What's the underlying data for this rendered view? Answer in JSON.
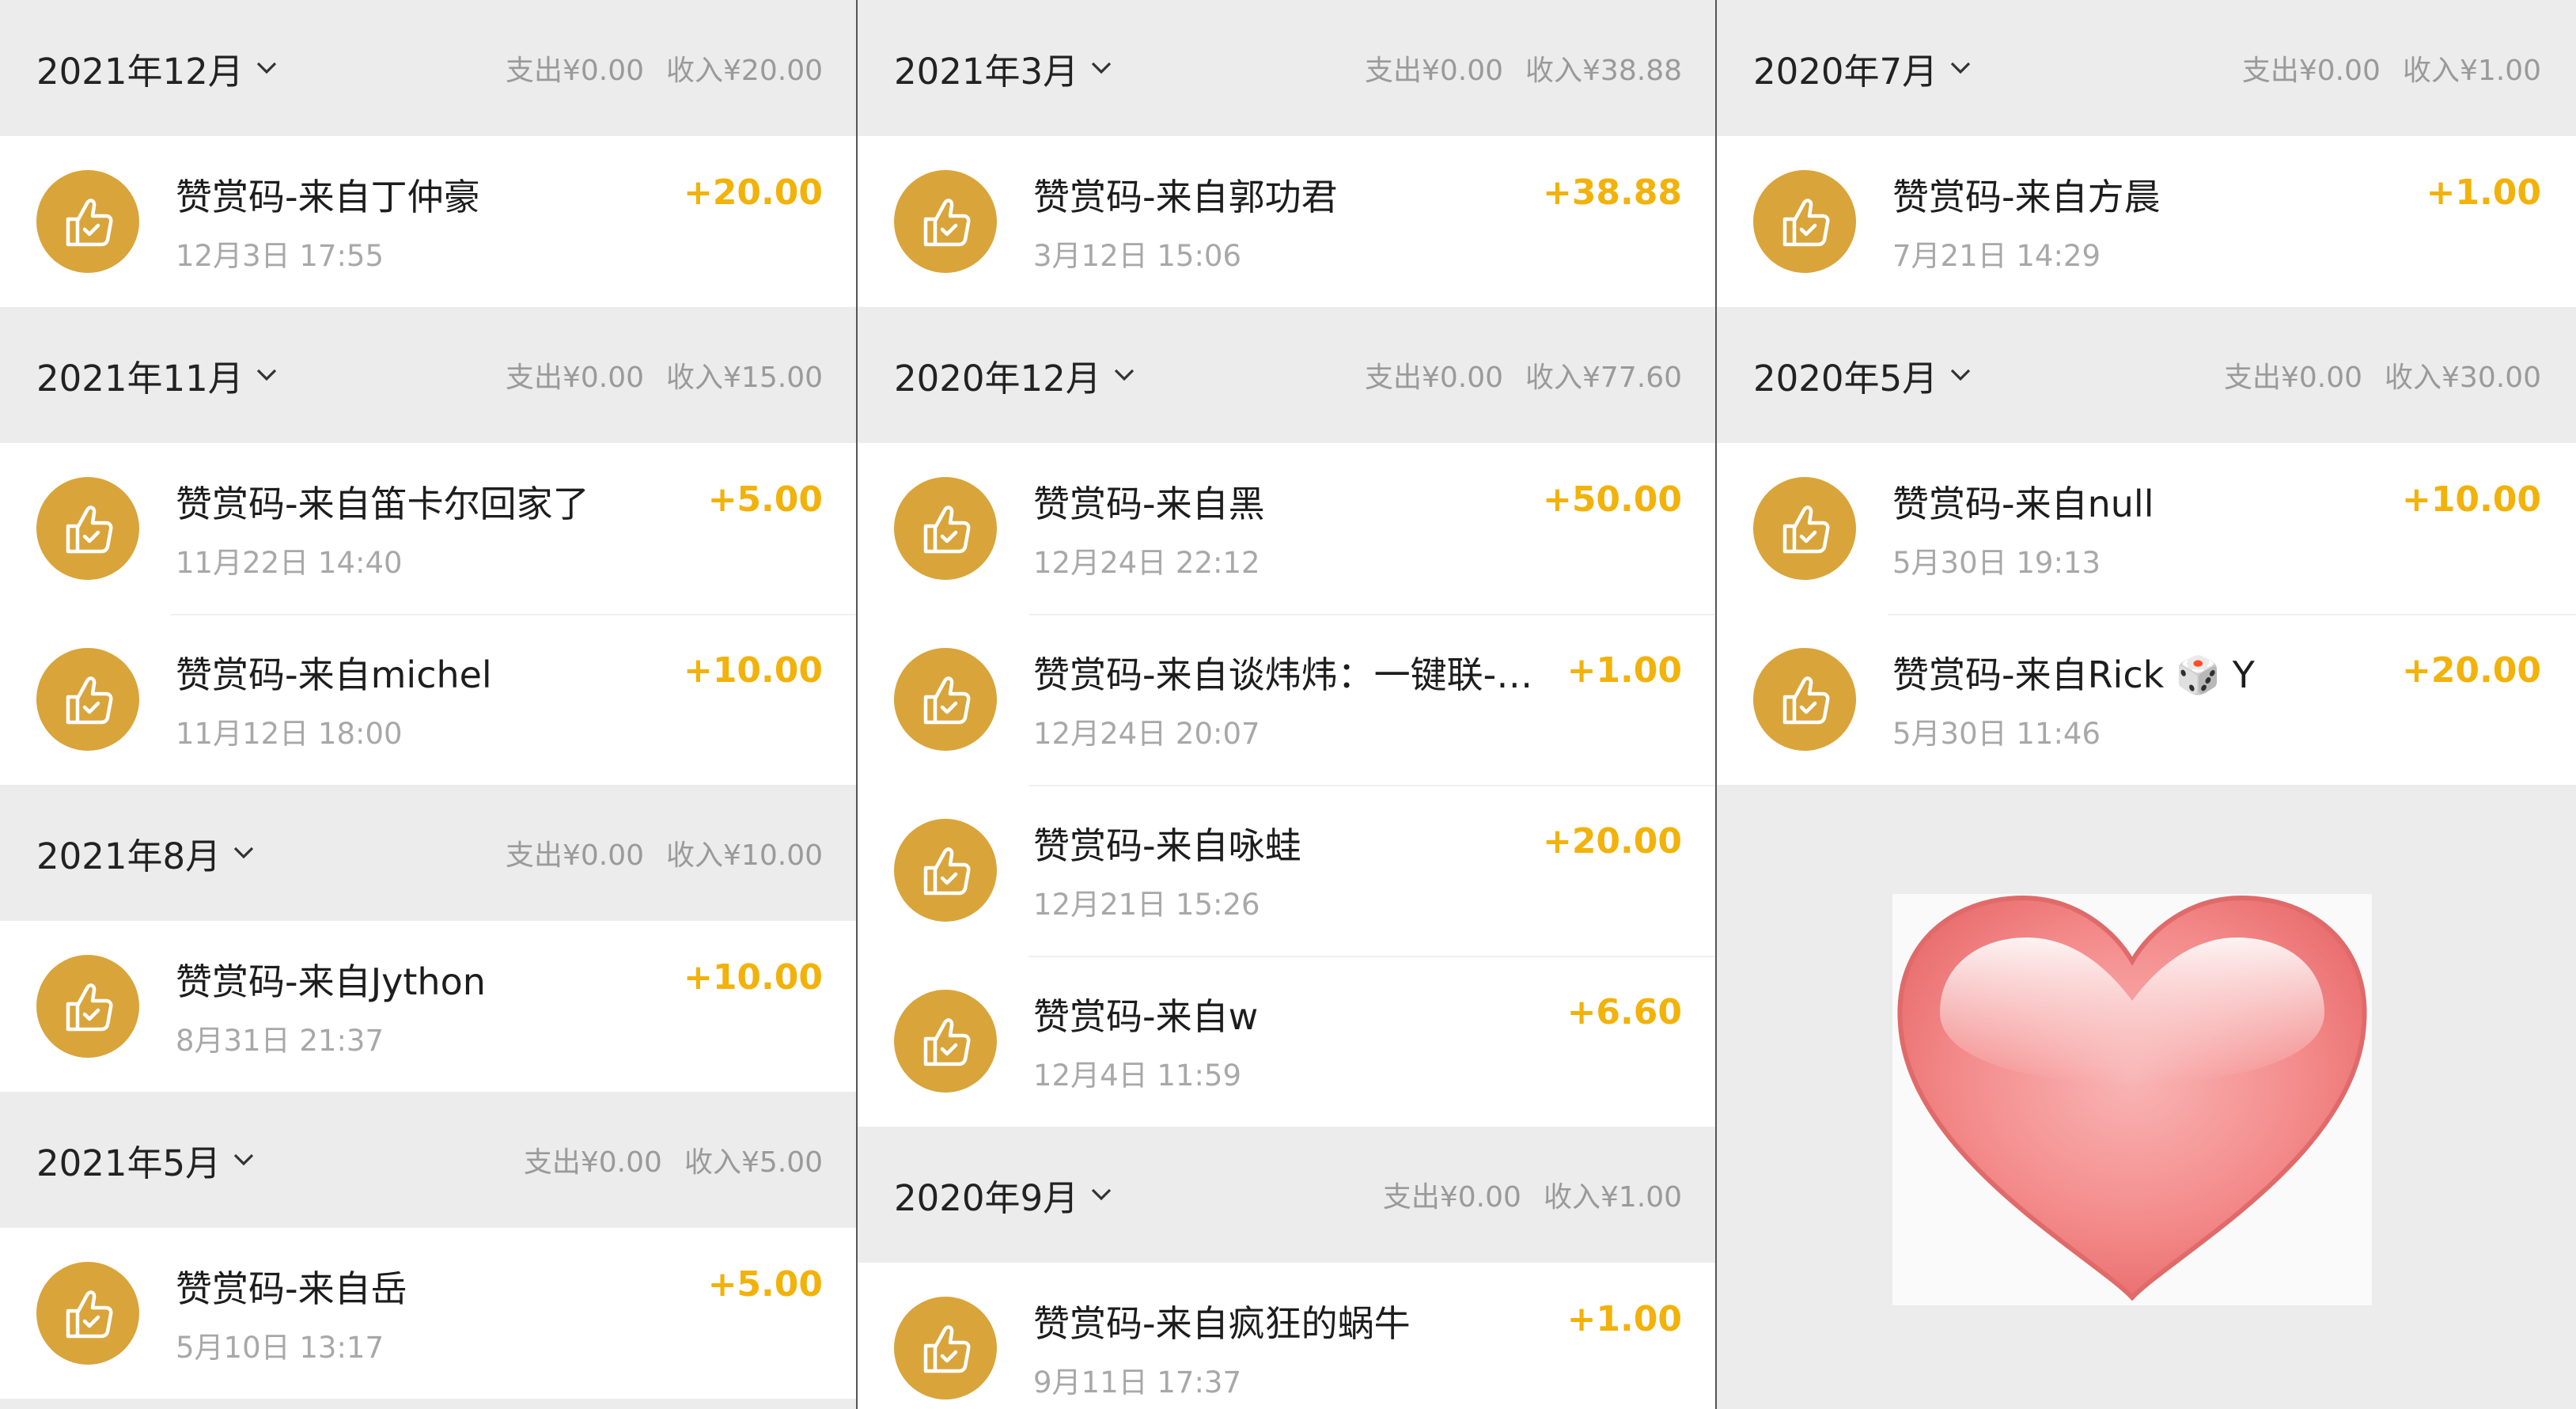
{
  "columns": [
    {
      "groups": [
        {
          "month": "2021年12月",
          "expense": "支出¥0.00",
          "income": "收入¥20.00",
          "items": [
            {
              "title": "赞赏码-来自丁仲豪",
              "time": "12月3日 17:55",
              "amount": "+20.00"
            }
          ]
        },
        {
          "month": "2021年11月",
          "expense": "支出¥0.00",
          "income": "收入¥15.00",
          "items": [
            {
              "title": "赞赏码-来自笛卡尔回家了",
              "time": "11月22日 14:40",
              "amount": "+5.00"
            },
            {
              "title": "赞赏码-来自michel",
              "time": "11月12日 18:00",
              "amount": "+10.00"
            }
          ]
        },
        {
          "month": "2021年8月",
          "expense": "支出¥0.00",
          "income": "收入¥10.00",
          "items": [
            {
              "title": "赞赏码-来自Jython",
              "time": "8月31日 21:37",
              "amount": "+10.00"
            }
          ]
        },
        {
          "month": "2021年5月",
          "expense": "支出¥0.00",
          "income": "收入¥5.00",
          "items": [
            {
              "title": "赞赏码-来自岳",
              "time": "5月10日 13:17",
              "amount": "+5.00"
            }
          ]
        }
      ]
    },
    {
      "groups": [
        {
          "month": "2021年3月",
          "expense": "支出¥0.00",
          "income": "收入¥38.88",
          "items": [
            {
              "title": "赞赏码-来自郭功君",
              "time": "3月12日 15:06",
              "amount": "+38.88"
            }
          ]
        },
        {
          "month": "2020年12月",
          "expense": "支出¥0.00",
          "income": "收入¥77.60",
          "items": [
            {
              "title": "赞赏码-来自黑",
              "time": "12月24日 22:12",
              "amount": "+50.00"
            },
            {
              "title": "赞赏码-来自谈炜炜：一键联-…",
              "time": "12月24日 20:07",
              "amount": "+1.00"
            },
            {
              "title": "赞赏码-来自咏蛙",
              "time": "12月21日 15:26",
              "amount": "+20.00"
            },
            {
              "title": "赞赏码-来自w",
              "time": "12月4日 11:59",
              "amount": "+6.60"
            }
          ]
        },
        {
          "month": "2020年9月",
          "expense": "支出¥0.00",
          "income": "收入¥1.00",
          "items": [
            {
              "title": "赞赏码-来自疯狂的蜗牛",
              "time": "9月11日 17:37",
              "amount": "+1.00"
            }
          ]
        }
      ]
    },
    {
      "groups": [
        {
          "month": "2020年7月",
          "expense": "支出¥0.00",
          "income": "收入¥1.00",
          "items": [
            {
              "title": "赞赏码-来自方晨",
              "time": "7月21日 14:29",
              "amount": "+1.00"
            }
          ]
        },
        {
          "month": "2020年5月",
          "expense": "支出¥0.00",
          "income": "收入¥30.00",
          "items": [
            {
              "title": "赞赏码-来自null",
              "time": "5月30日 19:13",
              "amount": "+10.00"
            },
            {
              "title": "赞赏码-来自Rick 🎲 Y",
              "time": "5月30日 11:46",
              "amount": "+20.00"
            }
          ]
        }
      ]
    }
  ],
  "icons": {
    "avatar": "reward-code-thumbs-up-icon",
    "dropdown": "chevron-down-icon",
    "sticker": "heart-icon"
  },
  "colors": {
    "accent_amount": "#f2b20a",
    "avatar_bg": "#d9a43a",
    "header_bg": "#ececec",
    "heart": "#f28b8b"
  }
}
